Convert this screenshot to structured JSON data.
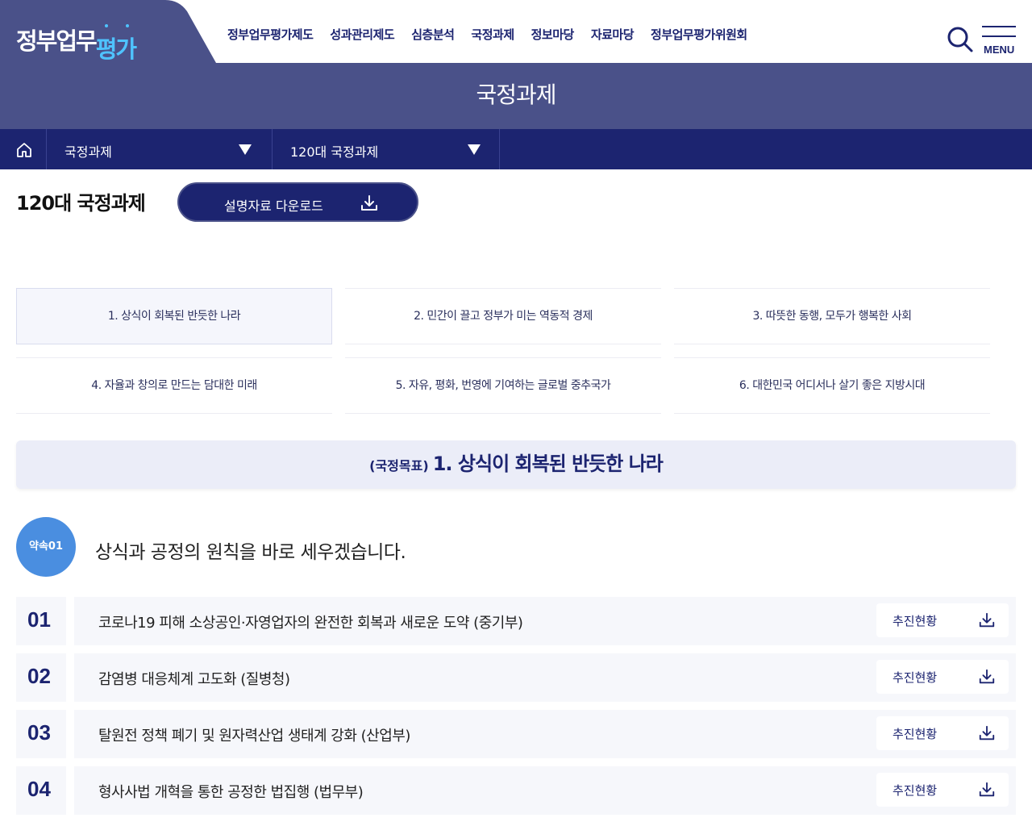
{
  "header": {
    "logo": {
      "part1": "정부업무",
      "part2": "평가"
    },
    "nav": [
      "정부업무평가제도",
      "성과관리제도",
      "심층분석",
      "국정과제",
      "정보마당",
      "자료마당",
      "정부업무평가위원회"
    ],
    "menu_label": "MENU",
    "page_title": "국정과제"
  },
  "subnav": {
    "dropdown1": "국정과제",
    "dropdown2": "120대 국정과제"
  },
  "content": {
    "title": "120대 국정과제",
    "download_label": "설명자료 다운로드",
    "goal_tabs": [
      "1. 상식이 회복된 반듯한 나라",
      "2. 민간이 끌고 정부가 미는 역동적 경제",
      "3. 따뜻한 동행, 모두가 행복한 사회",
      "4. 자율과 창의로 만드는 담대한 미래",
      "5. 자유, 평화, 번영에 기여하는 글로벌 중추국가",
      "6. 대한민국 어디서나 살기 좋은 지방시대"
    ],
    "goal_banner": {
      "prefix": "(국정목표)",
      "title": "1. 상식이 회복된 반듯한 나라"
    },
    "promise": {
      "badge": "약속01",
      "text": "상식과 공정의 원칙을 바로 세우겠습니다."
    },
    "tasks": [
      {
        "num": "01",
        "title": "코로나19 피해 소상공인·자영업자의 완전한 회복과 새로운 도약 (중기부)",
        "status": "추진현황"
      },
      {
        "num": "02",
        "title": "감염병 대응체계 고도화 (질병청)",
        "status": "추진현황"
      },
      {
        "num": "03",
        "title": "탈원전 정책 폐기 및 원자력산업 생태계 강화 (산업부)",
        "status": "추진현황"
      },
      {
        "num": "04",
        "title": "형사사법 개혁을 통한 공정한 법집행 (법무부)",
        "status": "추진현황"
      }
    ]
  },
  "colors": {
    "navy": "#1c2470",
    "band": "#4a5189",
    "accent": "#4fc3ff",
    "badge": "#4a8ee0"
  }
}
